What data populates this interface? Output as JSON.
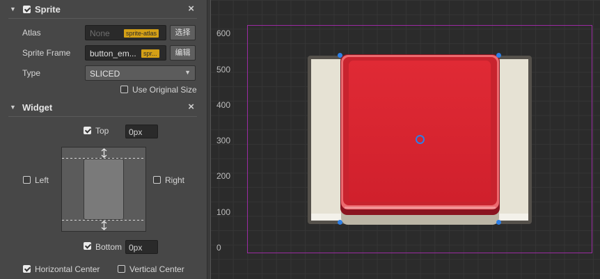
{
  "sprite": {
    "title": "Sprite",
    "enabled": true,
    "atlas_label": "Atlas",
    "atlas_value": "None",
    "atlas_tag": "sprite-atlas",
    "atlas_button": "选择",
    "frame_label": "Sprite Frame",
    "frame_value": "button_em...",
    "frame_tag": "spr...",
    "frame_button": "编辑",
    "type_label": "Type",
    "type_value": "SLICED",
    "use_original_label": "Use Original Size",
    "use_original_checked": false
  },
  "widget": {
    "title": "Widget",
    "top_label": "Top",
    "top_checked": true,
    "top_value": "0px",
    "left_label": "Left",
    "left_checked": false,
    "right_label": "Right",
    "right_checked": false,
    "bottom_label": "Bottom",
    "bottom_checked": true,
    "bottom_value": "0px",
    "hcenter_label": "Horizontal Center",
    "hcenter_checked": true,
    "vcenter_label": "Vertical Center",
    "vcenter_checked": false
  },
  "scene": {
    "y_axis_labels": [
      "600",
      "500",
      "400",
      "300",
      "200",
      "100",
      "0"
    ],
    "canvas_border_color": "#9b2aa3",
    "button_color": "#d9232f",
    "anchor_color": "#2d7fe6"
  }
}
